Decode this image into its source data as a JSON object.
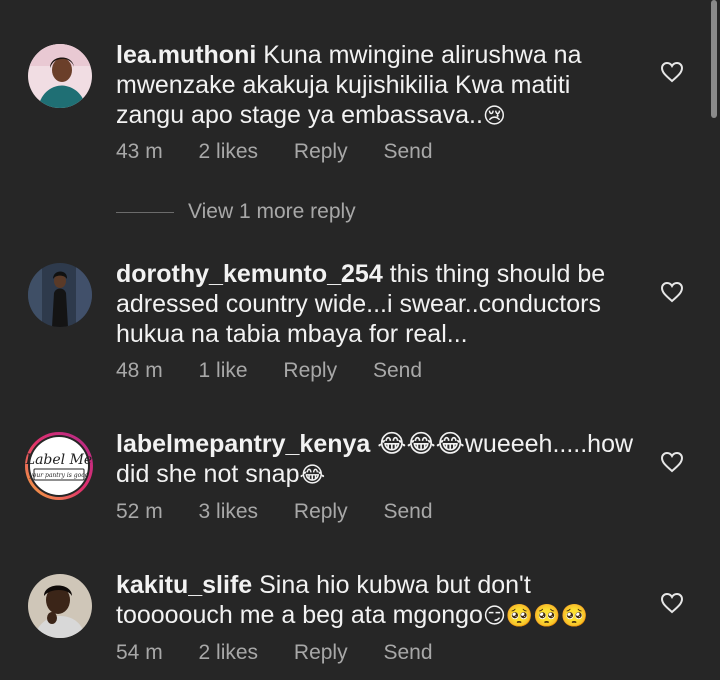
{
  "comments": [
    {
      "username": "lea.muthoni",
      "text": " Kuna mwingine alirushwa na mwenzake akakuja kujishikilia Kwa matiti zangu apo stage ya embassava..",
      "emoji": "😢",
      "time": "43 m",
      "likes": "2 likes",
      "reply": "Reply",
      "send": "Send"
    },
    {
      "username": "dorothy_kemunto_254",
      "text": " this thing should be adressed country wide...i swear..conductors hukua na tabia mbaya for real...",
      "emoji": "",
      "time": "48 m",
      "likes": "1 like",
      "reply": "Reply",
      "send": "Send"
    },
    {
      "username": "labelmepantry_kenya",
      "text_before": " 😂😂😂wueeeh.....how did she not snap",
      "emoji": "😂",
      "time": "52 m",
      "likes": "3 likes",
      "reply": "Reply",
      "send": "Send",
      "avatar_logo": "Label Me",
      "avatar_tagline": "your pantry is good"
    },
    {
      "username": "kakitu_slife",
      "text": " Sina hio kubwa but don't tooooouch me a beg ata mgongo",
      "emoji": "😏🥺🥺🥺",
      "time": "54 m",
      "likes": "2 likes",
      "reply": "Reply",
      "send": "Send"
    }
  ],
  "view_more_replies": "View 1 more reply",
  "icons": {
    "like": "heart-outline-icon"
  },
  "colors": {
    "background": "#262626",
    "text": "#f2f2f2",
    "secondary": "#a8a8a8"
  }
}
